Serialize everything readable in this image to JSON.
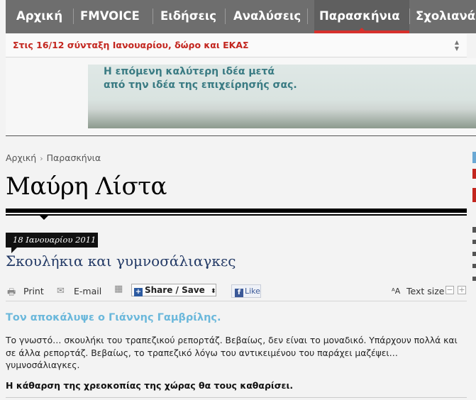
{
  "nav": {
    "items": [
      {
        "label": "Αρχική"
      },
      {
        "label": "FMVOICE"
      },
      {
        "label": "Ειδήσεις"
      },
      {
        "label": "Αναλύσεις"
      },
      {
        "label": "Παρασκήνια",
        "active": true
      },
      {
        "label": "Σχολιανά"
      }
    ]
  },
  "ticker": {
    "headline": "Στις 16/12 σύνταξη Ιανουαρίου, δώρο και ΕΚΑΣ",
    "arrows": "▲▼"
  },
  "banner": {
    "line1": "Η επόμενη καλύτερη ιδέα μετά",
    "line2": "από την ιδέα της επιχείρησής σας."
  },
  "breadcrumb": {
    "home": "Αρχική",
    "separator": "›",
    "current": "Παρασκήνια"
  },
  "page": {
    "title": "Μαύρη Λίστα"
  },
  "article": {
    "date": "18 Ιανουαρίου 2011",
    "title": "Σκουλήκια και γυμνοσάλιαγκες",
    "lead": "Τον αποκάλυψε ο Γιάννης Γαμβρίλης.",
    "body": "Το γνωστό… σκουλήκι του τραπεζικού ρεπορτάζ. Βεβαίως, δεν είναι το μοναδικό. Υπάρχουν πολλά και σε άλλα ρεπορτάζ. Βεβαίως, το τραπεζικό λόγω του αντικειμένου του παράχει μαζέψει… γυμνοσάλιαγκες.",
    "bold": "Η κάθαρση της χρεοκοπίας της χώρας θα τους καθαρίσει."
  },
  "tools": {
    "print": "Print",
    "email": "E-mail",
    "share": "Share / Save",
    "share_arrow": "⬍",
    "like": "Like",
    "text_size": "Text size",
    "minus": "−",
    "plus": "+"
  },
  "colors": {
    "nav_bg": "#6e6e6e",
    "accent_red": "#d6302c",
    "title_blue": "#233a66",
    "lead_blue": "#6bb8db"
  }
}
